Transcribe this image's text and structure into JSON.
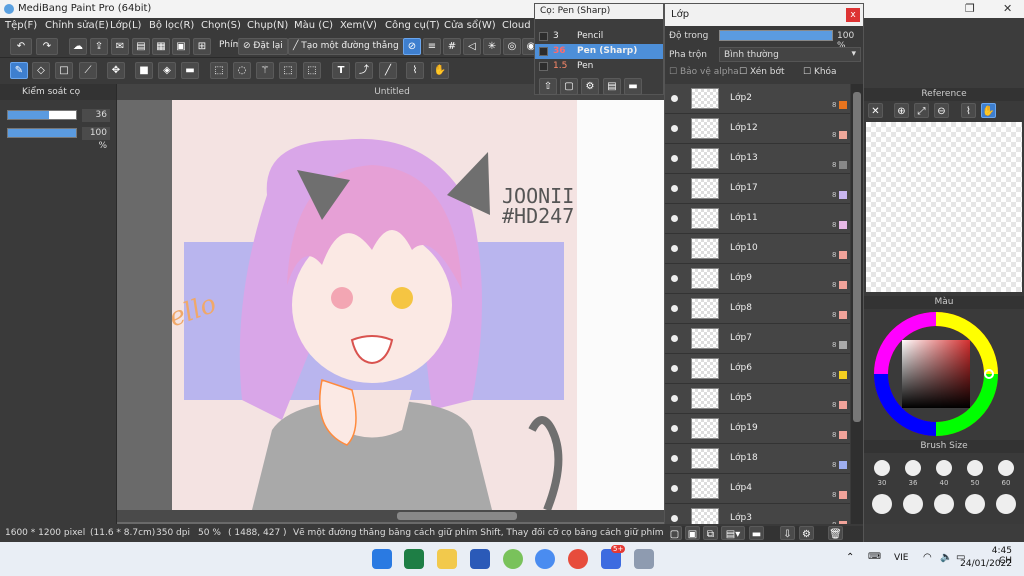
{
  "window": {
    "title": "MediBang Paint Pro (64bit)"
  },
  "menu": [
    "Tệp(F)",
    "Chỉnh sửa(E)",
    "Lớp(L)",
    "Bộ lọc(R)",
    "Chọn(S)",
    "Chụp(N)",
    "Màu (C)",
    "Xem(V)",
    "Công cụ(T)",
    "Cửa sổ(W)",
    "Cloud"
  ],
  "toolbar": {
    "key_label": "Phím",
    "reset_label": "Đặt lại",
    "line_label": "Tạo một đường thẳng"
  },
  "brush_control": {
    "title": "Kiểm soát cọ",
    "size_value": "36",
    "opacity_value": "100 %",
    "size_fraction": 0.6,
    "opacity_fraction": 1.0
  },
  "canvas": {
    "tab_title": "Untitled",
    "art_text_name": "JOONII",
    "art_text_tag": "#HD247",
    "art_text_hello": "Hello"
  },
  "brush_popup": {
    "title": "Cọ: Pen (Sharp)",
    "items": [
      {
        "size": "3",
        "name": "Pencil",
        "selected": false
      },
      {
        "size": "36",
        "name": "Pen (Sharp)",
        "selected": true
      },
      {
        "size": "1.5",
        "name": "Pen",
        "selected": false
      }
    ]
  },
  "layers_panel": {
    "title": "Lớp",
    "close_label": "x",
    "opacity_label": "Độ trong",
    "opacity_value": "100 %",
    "blend_label": "Pha trộn",
    "blend_value": "Bình thường",
    "protect_alpha_label": "Bảo vệ alpha",
    "clip_label": "Xén bớt",
    "lock_label": "Khóa",
    "bit_label": "8",
    "layers": [
      {
        "name": "Lớp2",
        "color": "#e8741e"
      },
      {
        "name": "Lớp12",
        "color": "#f0a89a"
      },
      {
        "name": "Lớp13",
        "color": "#888888"
      },
      {
        "name": "Lớp17",
        "color": "#c9b6f0"
      },
      {
        "name": "Lớp11",
        "color": "#e7b9e6"
      },
      {
        "name": "Lớp10",
        "color": "#f2a39a"
      },
      {
        "name": "Lớp9",
        "color": "#f2a39a"
      },
      {
        "name": "Lớp8",
        "color": "#f2a39a"
      },
      {
        "name": "Lớp7",
        "color": "#aaaaaa"
      },
      {
        "name": "Lớp6",
        "color": "#f5d020"
      },
      {
        "name": "Lớp5",
        "color": "#f2a39a"
      },
      {
        "name": "Lớp19",
        "color": "#f2a39a"
      },
      {
        "name": "Lớp18",
        "color": "#9eaef0"
      },
      {
        "name": "Lớp4",
        "color": "#f2a39a"
      },
      {
        "name": "Lớp3",
        "color": "#f2a39a"
      }
    ]
  },
  "reference_panel": {
    "title": "Reference"
  },
  "color_panel": {
    "title": "Màu"
  },
  "brush_size_panel": {
    "title": "Brush Size",
    "sizes": [
      "30",
      "36",
      "40",
      "50",
      "60"
    ]
  },
  "statusbar": {
    "dimensions": "1600 * 1200 pixel",
    "cm": "(11.6 * 8.7cm)",
    "dpi": "350 dpi",
    "zoom": "50 %",
    "coords": "( 1488, 427 )",
    "hint": "Vẽ một đường thẳng bằng cách giữ phím Shift, Thay đổi cỡ cọ bằng cách giữ phím C"
  },
  "taskbar": {
    "lang": "VIE",
    "time": "4:45 CH",
    "date": "24/01/2022",
    "badge": "5+"
  }
}
